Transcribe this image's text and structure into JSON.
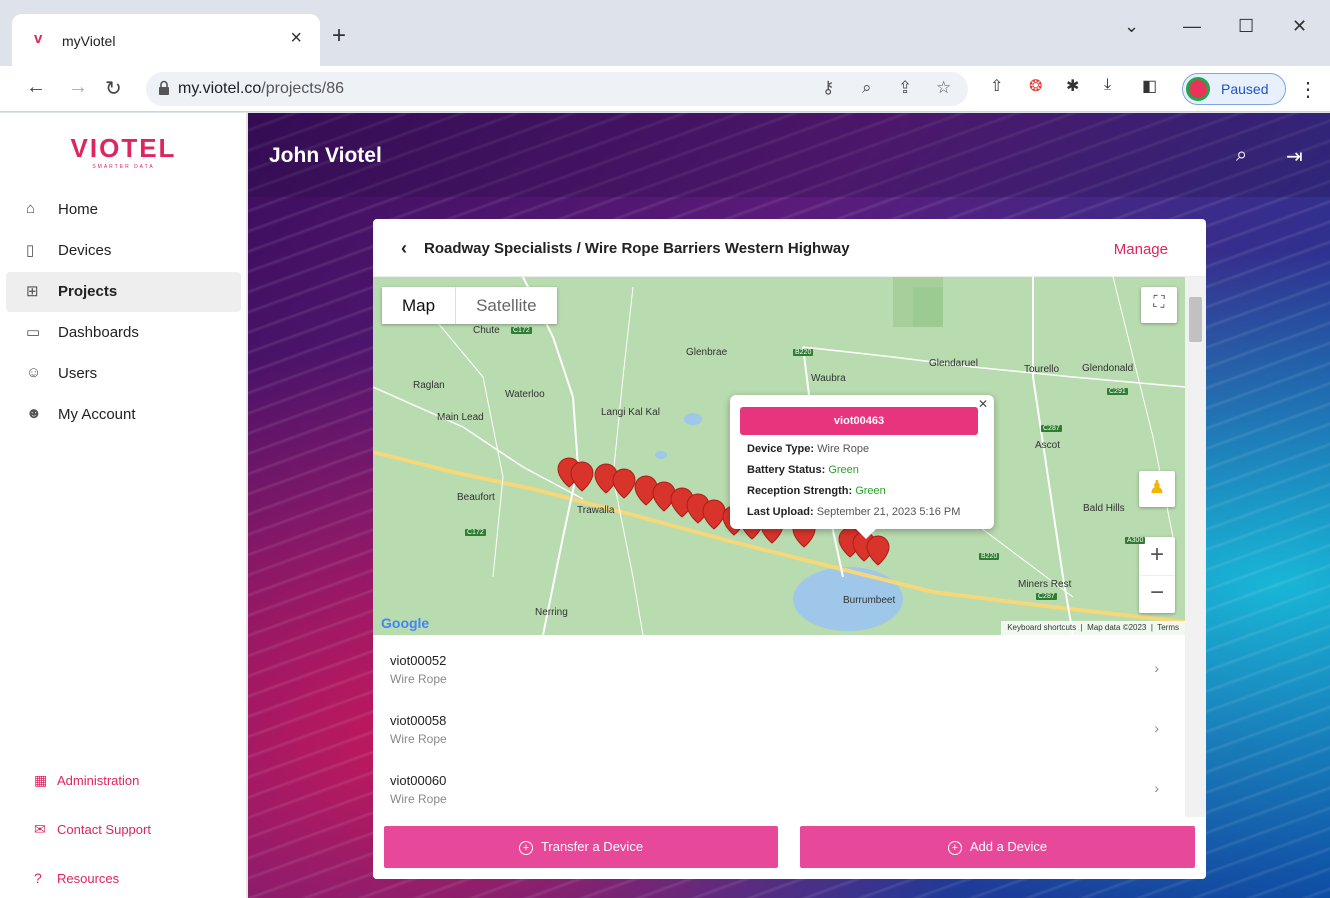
{
  "browser": {
    "tab_title": "myViotel",
    "tab_favicon": "v",
    "url_domain": "my.viotel.co",
    "url_path": "/projects/86",
    "profile_status": "Paused"
  },
  "sidebar": {
    "logo": "VIOTEL",
    "logo_tagline": "SMARTER DATA",
    "items": [
      {
        "label": "Home",
        "icon": "home-icon"
      },
      {
        "label": "Devices",
        "icon": "device-icon"
      },
      {
        "label": "Projects",
        "icon": "grid-icon"
      },
      {
        "label": "Dashboards",
        "icon": "clipboard-icon"
      },
      {
        "label": "Users",
        "icon": "users-icon"
      },
      {
        "label": "My Account",
        "icon": "user-icon"
      }
    ],
    "active": "Projects",
    "footer": [
      {
        "label": "Administration",
        "icon": "building-icon"
      },
      {
        "label": "Contact Support",
        "icon": "mail-icon"
      },
      {
        "label": "Resources",
        "icon": "help-icon"
      }
    ]
  },
  "header": {
    "user_name": "John Viotel"
  },
  "project": {
    "breadcrumb": "Roadway Specialists / Wire Rope Barriers Western Highway",
    "manage_label": "Manage"
  },
  "map": {
    "type_map": "Map",
    "type_satellite": "Satellite",
    "places": [
      "Chute",
      "Glenbrae",
      "Waubra",
      "Glendaruel",
      "Tourello",
      "Glendonald",
      "Raglan",
      "Waterloo",
      "Main Lead",
      "Langi Kal Kal",
      "Ascot",
      "Beaufort",
      "Trawalla",
      "Bald Hills",
      "Nerring",
      "Burrumbeet",
      "Miners Rest"
    ],
    "roads": [
      "C172",
      "B220",
      "C291",
      "C287",
      "C172",
      "B220",
      "C287",
      "A300"
    ],
    "google_label": "Google",
    "footer_shortcuts": "Keyboard shortcuts",
    "footer_data": "Map data ©2023",
    "footer_terms": "Terms",
    "popup": {
      "device_id": "viot00463",
      "device_type_label": "Device Type:",
      "device_type": "Wire Rope",
      "battery_label": "Battery Status:",
      "battery": "Green",
      "reception_label": "Reception Strength:",
      "reception": "Green",
      "upload_label": "Last Upload:",
      "upload": "September 21, 2023 5:16 PM"
    }
  },
  "devices": [
    {
      "id": "viot00052",
      "type": "Wire Rope"
    },
    {
      "id": "viot00058",
      "type": "Wire Rope"
    },
    {
      "id": "viot00060",
      "type": "Wire Rope"
    }
  ],
  "actions": {
    "transfer": "Transfer a Device",
    "add": "Add a Device"
  },
  "colors": {
    "brand": "#e0245e",
    "button": "#e8489a",
    "status_green": "#2ca02c"
  }
}
